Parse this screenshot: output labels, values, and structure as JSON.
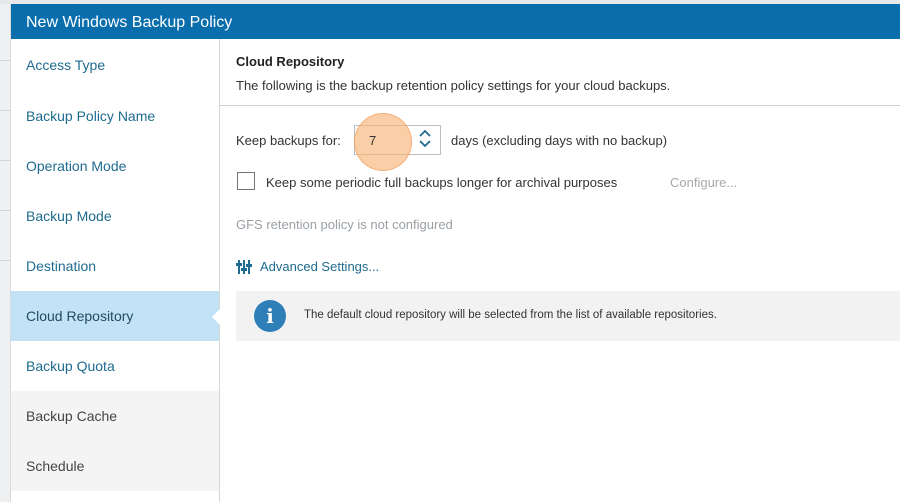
{
  "window": {
    "title": "New Windows Backup Policy"
  },
  "sidebar": {
    "items": [
      {
        "label": "Access Type"
      },
      {
        "label": "Backup Policy Name"
      },
      {
        "label": "Operation Mode"
      },
      {
        "label": "Backup Mode"
      },
      {
        "label": "Destination"
      },
      {
        "label": "Cloud Repository"
      },
      {
        "label": "Backup Quota"
      },
      {
        "label": "Backup Cache"
      },
      {
        "label": "Schedule"
      }
    ]
  },
  "main": {
    "title": "Cloud Repository",
    "description": "The following is the backup retention policy settings for your cloud backups.",
    "keep_label": "Keep backups for:",
    "keep_value": "7",
    "days_label": "days (excluding days with no backup)",
    "archival_checkbox_label": "Keep some periodic full backups longer for archival purposes",
    "archival_checked": false,
    "configure_label": "Configure...",
    "gfs_status": "GFS retention policy is not configured",
    "advanced_settings_label": "Advanced Settings...",
    "info_text": "The default cloud repository will be selected from the list of available repositories."
  },
  "icons": {
    "stepper_up": "chevron-up-icon",
    "stepper_down": "chevron-down-icon",
    "advanced": "sliders-icon",
    "info": "info-icon"
  },
  "colors": {
    "titlebar": "#0a6ead",
    "active_nav": "#c2e3f6",
    "link": "#1e6b8f",
    "info_icon": "#2e7fb8",
    "highlight": "#f8b478"
  }
}
